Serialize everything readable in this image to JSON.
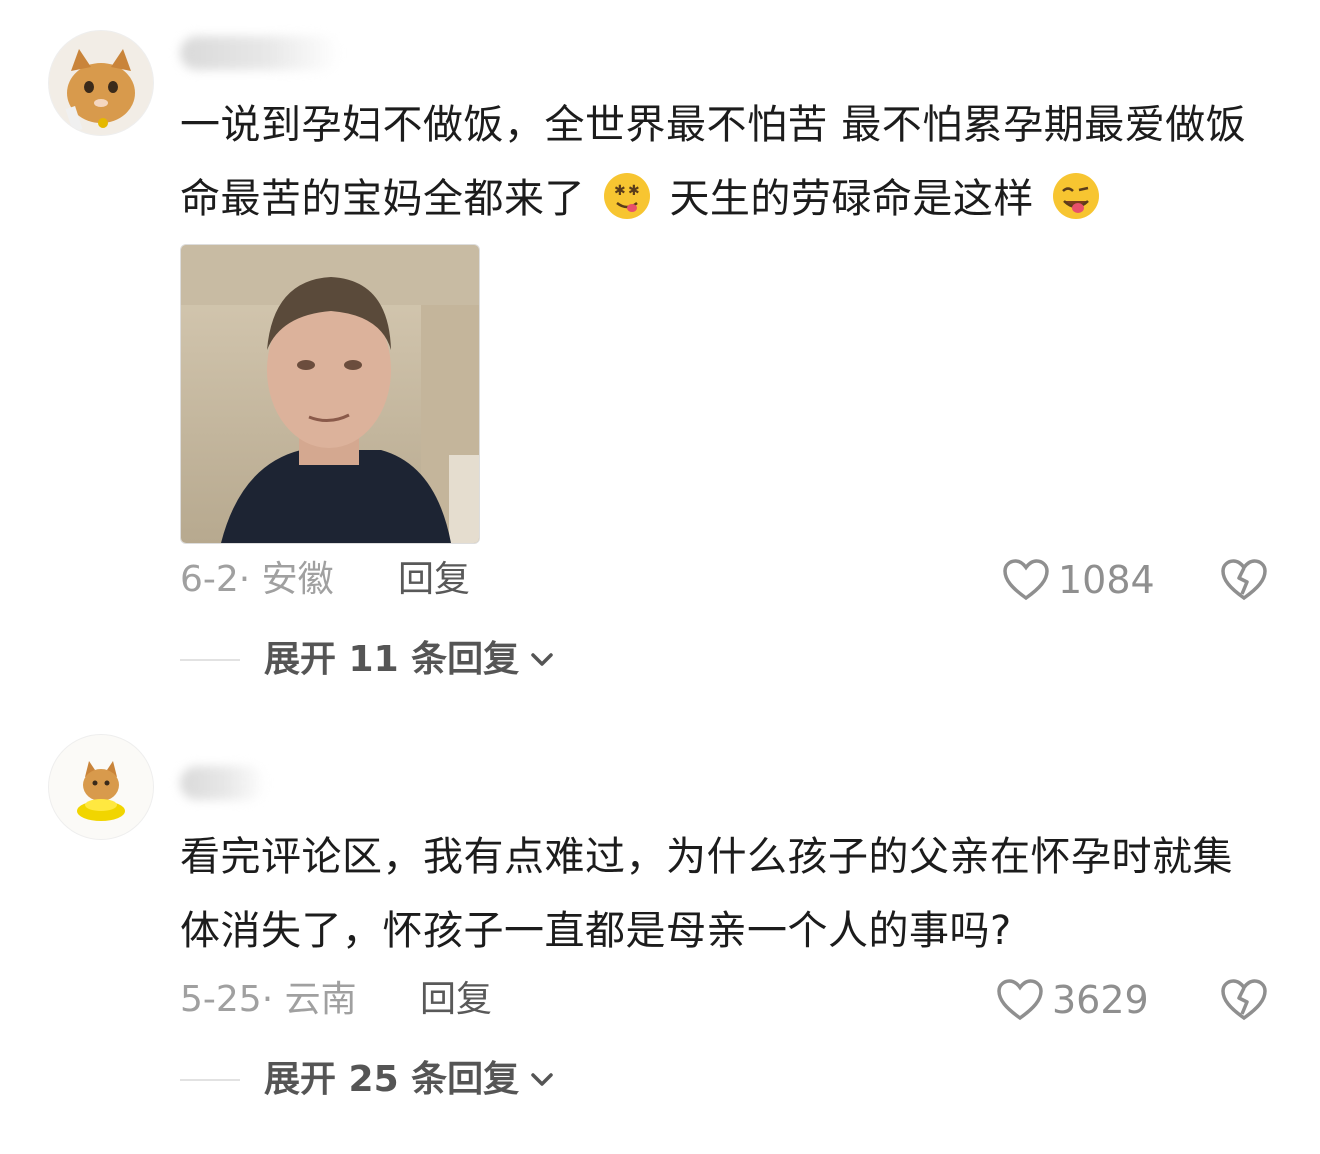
{
  "comments": [
    {
      "text": "一说到孕妇不做饭，全世界最不怕苦 最不怕累孕期最爱做饭 命最苦的宝妈全都来了",
      "text_tail": "天生的劳碌命是这样",
      "emoji_1": "drooling-face-emoji",
      "emoji_2": "winking-tongue-emoji",
      "date_location": "6-2· 安徽",
      "reply_label": "回复",
      "likes": "1084",
      "expand_label": "展开 11 条回复",
      "avatar_icon": "cat-avatar-icon",
      "photo_icon": "man-photo"
    },
    {
      "text": "看完评论区，我有点难过，为什么孩子的父亲在怀孕时就集体消失了，怀孩子一直都是母亲一个人的事吗?",
      "date_location": "5-25· 云南",
      "reply_label": "回复",
      "likes": "3629",
      "expand_label": "展开 25 条回复",
      "avatar_icon": "cat-avatar-icon"
    }
  ],
  "colors": {
    "text": "#1c1c1c",
    "meta": "#a0a0a0",
    "icon": "#8f8f8f",
    "emoji": "#f7c531"
  }
}
